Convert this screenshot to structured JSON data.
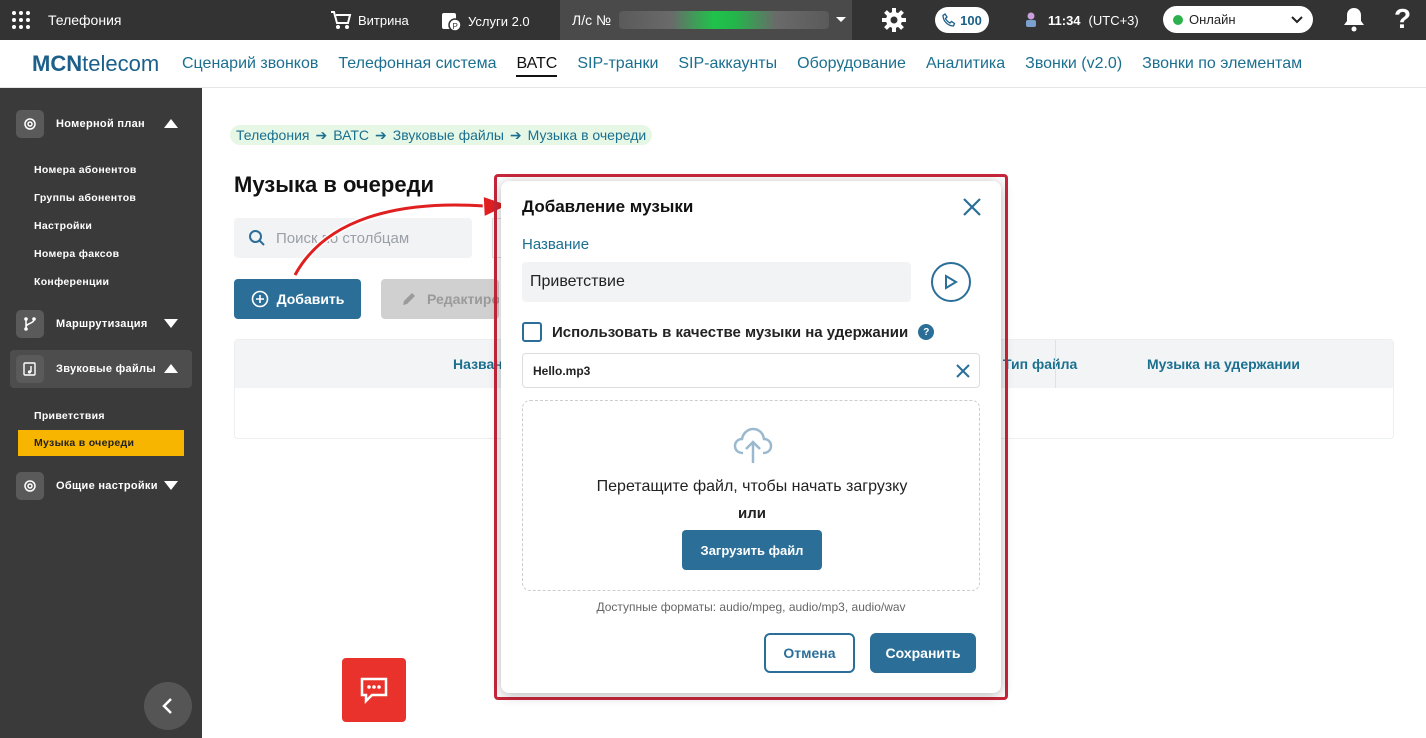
{
  "topbar": {
    "app_title": "Телефония",
    "showcase_label": "Витрина",
    "services_label": "Услуги 2.0",
    "account_label": "Л/с №",
    "calls_count": "100",
    "time": "11:34",
    "timezone": "(UTC+3)",
    "status": "Онлайн",
    "help": "?"
  },
  "nav": {
    "logo_bold": "MCN",
    "logo_rest": "telecom",
    "items": [
      "Сценарий звонков",
      "Телефонная система",
      "ВАТС",
      "SIP-транки",
      "SIP-аккаунты",
      "Оборудование",
      "Аналитика",
      "Звонки (v2.0)",
      "Звонки по элементам"
    ]
  },
  "sidebar": {
    "sections": [
      {
        "label": "Номерной план",
        "icon": "gear-icon",
        "expanded": true
      },
      {
        "label": "Маршрутизация",
        "icon": "branch-icon",
        "expanded": false
      },
      {
        "label": "Звуковые файлы",
        "icon": "music-file-icon",
        "expanded": true
      },
      {
        "label": "Общие настройки",
        "icon": "gear-icon",
        "expanded": false
      }
    ],
    "number_plan_items": [
      "Номера абонентов",
      "Группы абонентов",
      "Настройки",
      "Номера факсов",
      "Конференции"
    ],
    "sound_items": [
      "Приветствия",
      "Музыка в очереди"
    ]
  },
  "breadcrumb": [
    "Телефония",
    "ВАТС",
    "Звуковые файлы",
    "Музыка в очереди"
  ],
  "page": {
    "title": "Музыка в очереди",
    "search_placeholder": "Поиск по столбцам",
    "add_label": "Добавить",
    "edit_label": "Редактировать"
  },
  "table": {
    "columns": [
      "Название",
      "Тип файла",
      "Музыка на удержании"
    ]
  },
  "modal": {
    "title": "Добавление музыки",
    "name_label": "Название",
    "name_value": "Приветствие",
    "hold_checkbox_label": "Использовать в качестве музыки на удержании",
    "file_name": "Hello.mp3",
    "drop_text": "Перетащите файл, чтобы начать загрузку",
    "or_text": "или",
    "upload_label": "Загрузить файл",
    "formats_text": "Доступные форматы: audio/mpeg, audio/mp3, audio/wav",
    "cancel_label": "Отмена",
    "save_label": "Сохранить"
  },
  "colors": {
    "accent": "#2b6f99",
    "sidebar_bg": "#3a3a3a",
    "active_item": "#f7b500",
    "highlight_frame": "#c8263a",
    "online": "#2bb24c",
    "chat": "#e8322b"
  }
}
